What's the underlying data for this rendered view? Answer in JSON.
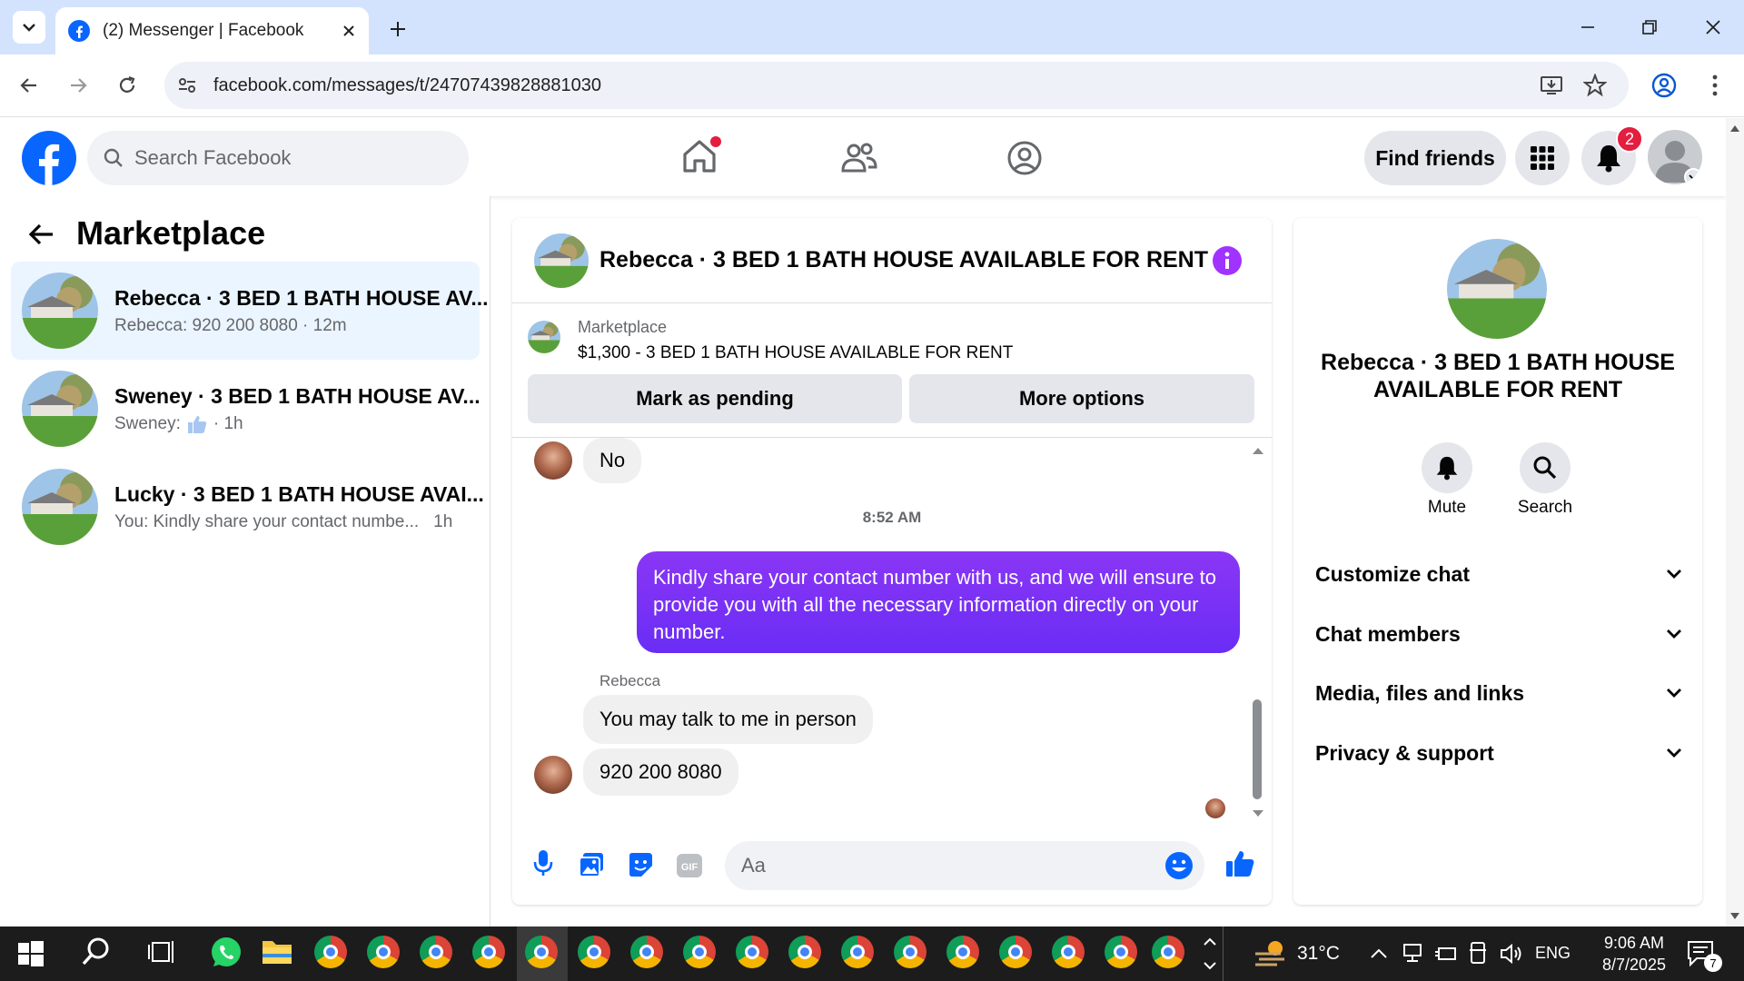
{
  "browser": {
    "tab_title": "(2) Messenger | Facebook",
    "url": "facebook.com/messages/t/24707439828881030"
  },
  "fb": {
    "search_placeholder": "Search Facebook",
    "find_friends": "Find friends",
    "notification_count": "2",
    "brand_color": "#0866ff"
  },
  "sidebar": {
    "title": "Marketplace",
    "conversations": [
      {
        "name": "Rebecca · 3 BED 1 BATH HOUSE AV...",
        "preview": "Rebecca: 920 200 8080 · 12m"
      },
      {
        "name": "Sweney · 3 BED 1 BATH HOUSE AV...",
        "preview_prefix": "Sweney:",
        "preview_suffix": "· 1h"
      },
      {
        "name": "Lucky · 3 BED 1 BATH HOUSE AVAI...",
        "preview": "You: Kindly share your contact numbe...",
        "time": "1h"
      }
    ]
  },
  "chat": {
    "title": "Rebecca · 3 BED 1 BATH HOUSE AVAILABLE FOR RENT",
    "listing_source": "Marketplace",
    "listing_title": "$1,300 - 3 BED 1 BATH HOUSE AVAILABLE FOR RENT",
    "mark_pending": "Mark as pending",
    "more_options": "More options",
    "messages": {
      "no": "No",
      "timestamp": "8:52 AM",
      "outgoing": "Kindly share your contact number with us, and we will ensure to provide you with all the necessary information directly on your number.",
      "sender": "Rebecca",
      "incoming1": "You may talk to me in person",
      "incoming2": "920 200 8080"
    },
    "composer_placeholder": "Aa",
    "outgoing_color": "#7b2ff7"
  },
  "info": {
    "title": "Rebecca · 3 BED 1 BATH HOUSE AVAILABLE FOR RENT",
    "mute": "Mute",
    "search": "Search",
    "sections": [
      "Customize chat",
      "Chat members",
      "Media, files and links",
      "Privacy & support"
    ]
  },
  "taskbar": {
    "temperature": "31°C",
    "language": "ENG",
    "time": "9:06 AM",
    "date": "8/7/2025",
    "notification_count": "7"
  }
}
